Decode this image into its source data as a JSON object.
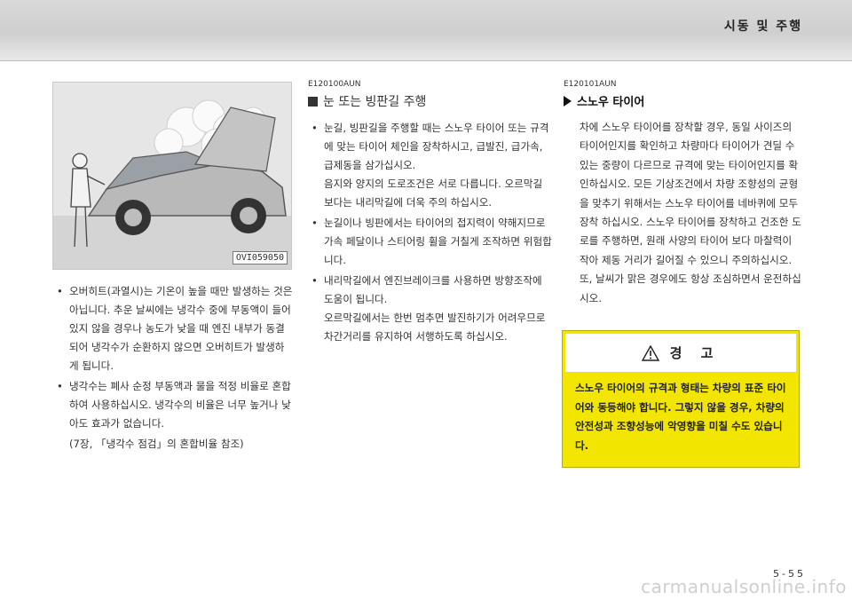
{
  "header": {
    "section_title": "시동 및 주행"
  },
  "figure": {
    "code": "OVI059050"
  },
  "left_column": {
    "bullets": [
      "오버히트(과열시)는 기온이 높을 때만 발생하는 것은 아닙니다. 추운 날씨에는 냉각수 중에 부동액이 들어있지 않을 경우나 농도가 낮을 때 엔진 내부가 동결되어 냉각수가 순환하지 않으면 오버히트가 발생하게 됩니다.",
      "냉각수는 폐사 순정 부동액과 물을 적정 비율로 혼합하여 사용하십시오. 냉각수의 비율은 너무 높거나 낮아도 효과가 없습니다."
    ],
    "note": "(7장, 「냉각수 점검」의 혼합비율 참조)"
  },
  "middle_column": {
    "code": "E120100AUN",
    "title": "눈 또는 빙판길 주행",
    "bullets": [
      {
        "text": "눈길, 빙판길을 주행할 때는 스노우 타이어 또는 규격에 맞는 타이어 체인을 장착하시고, 급발진, 급가속, 급제동을 삼가십시오.",
        "extra": "음지와 양지의 도로조건은 서로 다릅니다. 오르막길 보다는 내리막길에 더욱 주의 하십시오."
      },
      {
        "text": "눈길이나 빙판에서는 타이어의 접지력이 약해지므로 가속 페달이나 스티어링 휠을 거칠게 조작하면 위험합니다.",
        "extra": ""
      },
      {
        "text": "내리막길에서 엔진브레이크를 사용하면 방향조작에 도움이 됩니다.",
        "extra": "오르막길에서는 한번 멈추면 발진하기가 어려우므로 차간거리를 유지하여 서행하도록 하십시오."
      }
    ]
  },
  "right_column": {
    "code": "E120101AUN",
    "title": "스노우 타이어",
    "paragraph": "차에 스노우 타이어를 장착할 경우, 동일 사이즈의 타이어인지를 확인하고 차량마다 타이어가 견딜 수 있는 중량이 다르므로 규격에 맞는 타이어인지를 확인하십시오. 모든 기상조건에서 차량 조향성의 균형을 맞추기 위해서는 스노우 타이어를 네바퀴에 모두 장착 하십시오. 스노우 타이어를 장착하고 건조한 도로를 주행하면, 원래 사양의 타이어 보다 마찰력이 작아 제동 거리가 길어질 수 있으니 주의하십시오.",
    "paragraph2": "또, 날씨가 맑은 경우에도 항상 조심하면서 운전하십시오.",
    "warning": {
      "heading": "경 고",
      "body": "스노우 타이어의 규격과 형태는 차량의 표준 타이어와 동등해야 합니다. 그렇지 않을 경우, 차량의 안전성과 조향성능에 악영향을 미칠 수도 있습니다."
    }
  },
  "footer": {
    "page_number": "5-55"
  },
  "watermark": "carmanualsonline.info"
}
